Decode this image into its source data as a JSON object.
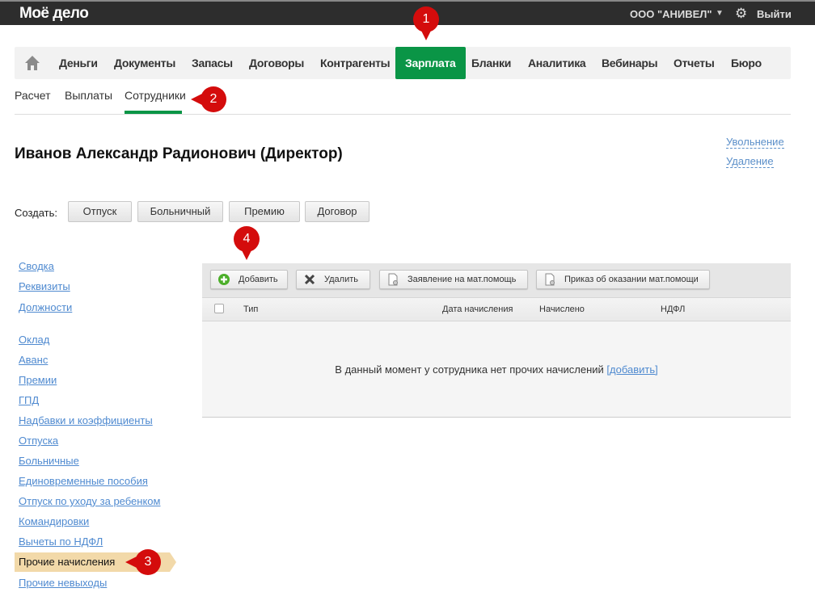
{
  "topbar": {
    "logo": "Моё дело",
    "org": "ООО \"АНИВЕЛ\"",
    "logout": "Выйти"
  },
  "nav": {
    "items": [
      {
        "label": "Деньги"
      },
      {
        "label": "Документы"
      },
      {
        "label": "Запасы"
      },
      {
        "label": "Договоры"
      },
      {
        "label": "Контрагенты"
      },
      {
        "label": "Зарплата",
        "active": true
      },
      {
        "label": "Бланки"
      },
      {
        "label": "Аналитика"
      },
      {
        "label": "Вебинары"
      },
      {
        "label": "Отчеты"
      },
      {
        "label": "Бюро"
      }
    ],
    "active_color": "#0a9546"
  },
  "subtabs": [
    {
      "label": "Расчет"
    },
    {
      "label": "Выплаты"
    },
    {
      "label": "Сотрудники",
      "active": true
    }
  ],
  "employee": {
    "title": "Иванов Александр Радионович (Директор)",
    "actions": [
      "Увольнение",
      "Удаление"
    ]
  },
  "create": {
    "label": "Создать:",
    "buttons": [
      "Отпуск",
      "Больничный",
      "Премию",
      "Договор"
    ]
  },
  "sidebar": {
    "group1": [
      "Сводка",
      "Реквизиты",
      "Должности"
    ],
    "group2": [
      "Оклад",
      "Аванс",
      "Премии",
      "ГПД",
      "Надбавки и коэффициенты",
      "Отпуска",
      "Больничные",
      "Единовременные пособия",
      "Отпуск по уходу за ребенком",
      "Командировки",
      "Вычеты по НДФЛ"
    ],
    "active": "Прочие начисления",
    "after": [
      "Прочие невыходы"
    ]
  },
  "toolbar": {
    "add": "Добавить",
    "delete": "Удалить",
    "statement": "Заявление на мат.помощь",
    "order": "Приказ об оказании мат.помощи"
  },
  "table": {
    "columns": [
      "Тип",
      "Дата начисления",
      "Начислено",
      "НДФЛ"
    ],
    "empty_text": "В данный момент у сотрудника нет прочих начислений ",
    "empty_link": "[добавить]"
  },
  "markers": [
    "1",
    "2",
    "3",
    "4"
  ]
}
